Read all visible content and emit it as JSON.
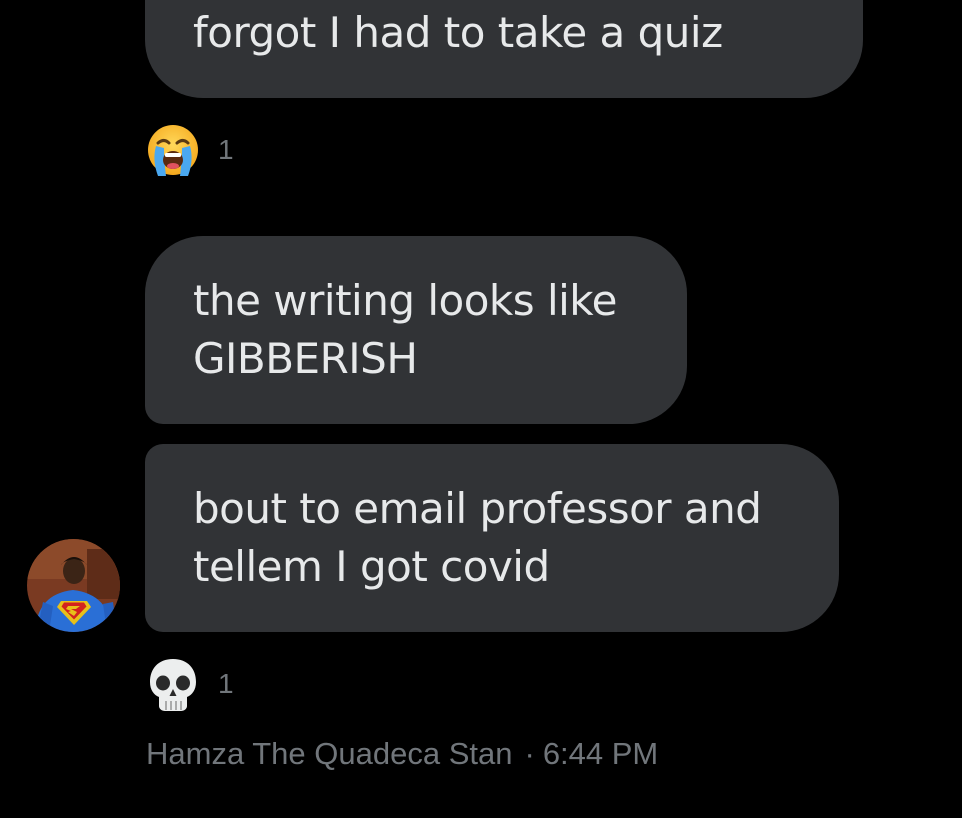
{
  "messages": [
    {
      "lines": [
        "forgot I had to take a quiz"
      ]
    },
    {
      "lines": [
        "the writing looks like",
        "GIBBERISH"
      ]
    },
    {
      "lines": [
        "bout to email professor and",
        "tellem I got covid"
      ]
    }
  ],
  "reactions": [
    {
      "emoji": "loudly-crying-face",
      "count": "1"
    },
    {
      "emoji": "skull",
      "count": "1"
    }
  ],
  "sender": {
    "name": "Hamza The Quadeca Stan",
    "separator": "·",
    "time": "6:44 PM"
  },
  "colors": {
    "background": "#000000",
    "bubble": "#313336",
    "text": "#e7e9ea",
    "muted": "#71767b"
  }
}
